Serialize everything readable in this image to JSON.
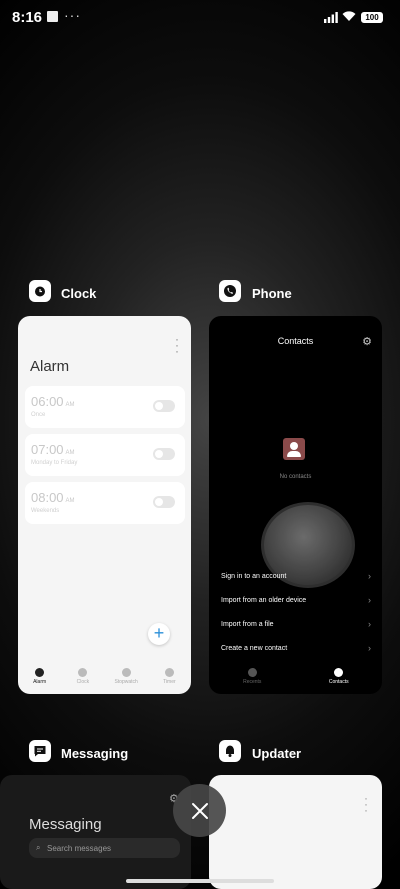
{
  "status_bar": {
    "time": "8:16",
    "dots": "···",
    "battery": "100"
  },
  "apps": {
    "clock": {
      "name": "Clock",
      "screen": {
        "title": "Alarm",
        "alarms": [
          {
            "time": "06:00",
            "ampm": "AM",
            "repeat": "Once"
          },
          {
            "time": "07:00",
            "ampm": "AM",
            "repeat": "Monday to Friday"
          },
          {
            "time": "08:00",
            "ampm": "AM",
            "repeat": "Weekends"
          }
        ],
        "add_symbol": "+",
        "tabs": [
          "Alarm",
          "Clock",
          "Stopwatch",
          "Timer"
        ]
      }
    },
    "phone": {
      "name": "Phone",
      "screen": {
        "title": "Contacts",
        "empty_text": "No contacts",
        "menu": [
          "Sign in to an account",
          "Import from an older device",
          "Import from a file",
          "Create a new contact"
        ],
        "tabs": [
          "Recents",
          "Contacts"
        ]
      }
    },
    "messaging": {
      "name": "Messaging",
      "screen": {
        "title": "Messaging",
        "search_placeholder": "Search messages"
      }
    },
    "updater": {
      "name": "Updater"
    }
  },
  "colors": {
    "accent_blue": "#2b8fd8",
    "contact_icon": "#8a4a4a"
  }
}
